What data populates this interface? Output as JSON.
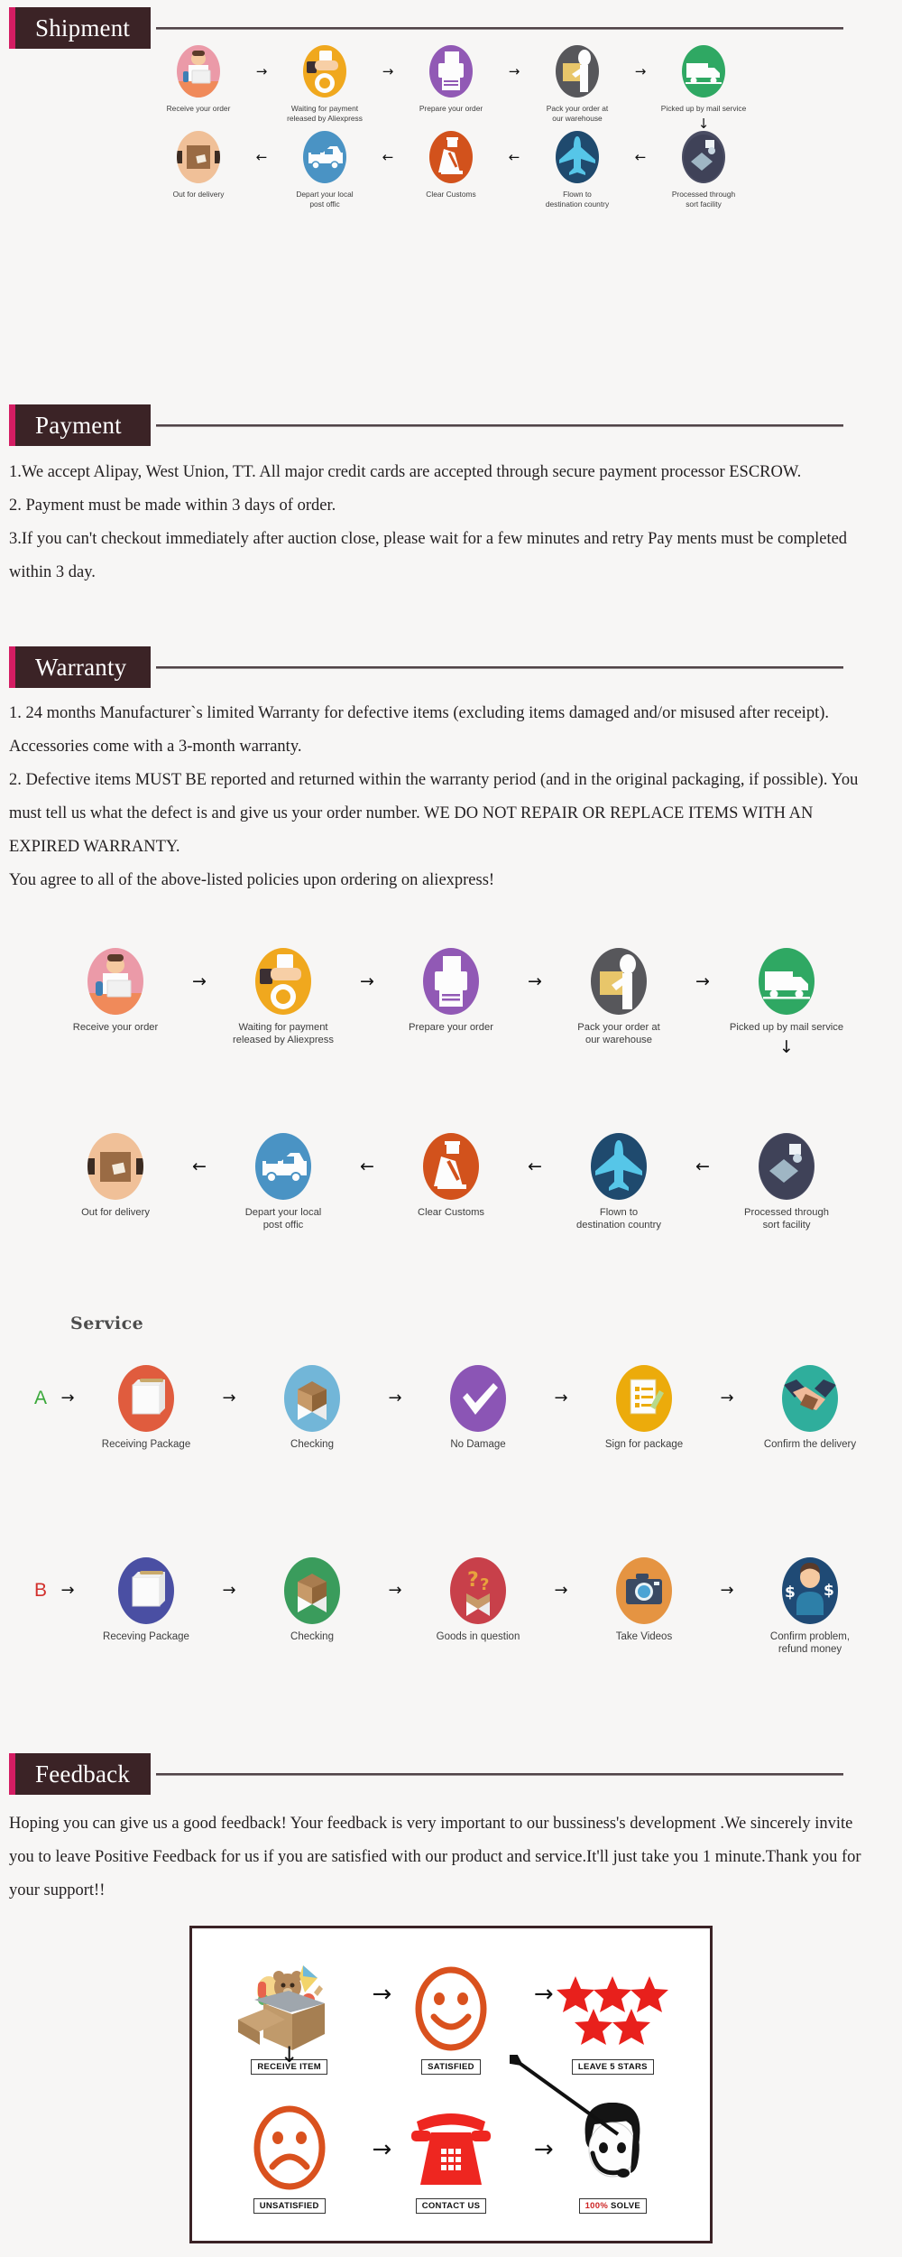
{
  "page": {
    "background": "#f7f6f5",
    "accent_bar_color": "#d41d63",
    "plate_color": "#3b2326"
  },
  "sections": {
    "shipment": {
      "title": "Shipment"
    },
    "payment": {
      "title": "Payment",
      "paragraphs": [
        "1.We accept Alipay, West Union, TT. All major credit cards are accepted through secure payment processor ESCROW.",
        "2. Payment must be made within 3 days of order.",
        "3.If you can't checkout immediately after auction close, please wait for a few minutes and retry Pay ments must be completed within 3 day."
      ]
    },
    "warranty": {
      "title": "Warranty",
      "paragraphs": [
        "1. 24 months Manufacturer`s limited Warranty for defective items (excluding items damaged and/or misused after receipt). Accessories come with a 3-month warranty.",
        "2. Defective items MUST BE reported and returned within the warranty period (and in the original packaging, if possible). You must tell us what the defect is and give us your order number. WE DO NOT REPAIR OR REPLACE ITEMS WITH AN EXPIRED WARRANTY.",
        "You agree to all of the above-listed policies upon ordering on aliexpress!"
      ]
    },
    "service": {
      "title": "Service"
    },
    "feedback": {
      "title": "Feedback",
      "paragraphs": [
        "Hoping you can give us a good feedback! Your feedback is very important to our bussiness's development .We sincerely invite you to leave Positive Feedback for us if you are satisfied with our product and service.It'll just take you 1 minute.Thank you for your support!!"
      ]
    }
  },
  "shipping_flow": {
    "row1": [
      {
        "label": "Receive your order",
        "icon": "person-at-desk-icon",
        "color": "#eb9aa8"
      },
      {
        "label": "Waiting for payment\nreleased by Aliexpress",
        "icon": "hand-with-coin-icon",
        "color": "#f0a81e"
      },
      {
        "label": "Prepare your order",
        "icon": "printer-icon",
        "color": "#9159b5"
      },
      {
        "label": "Pack your order at\nour warehouse",
        "icon": "worker-packing-icon",
        "color": "#57575b"
      },
      {
        "label": "Picked up by mail service",
        "icon": "delivery-truck-icon",
        "color": "#2fa863"
      }
    ],
    "row2": [
      {
        "label": "Out for delivery",
        "icon": "parcel-box-icon",
        "color": "#f0c098"
      },
      {
        "label": "Depart your local\npost offic",
        "icon": "delivery-van-icon",
        "color": "#4a93c4"
      },
      {
        "label": "Clear  Customs",
        "icon": "customs-officer-icon",
        "color": "#d2521c"
      },
      {
        "label": "Flown to\ndestination country",
        "icon": "airplane-icon",
        "color": "#1f4a6e"
      },
      {
        "label": "Processed through\nsort facility",
        "icon": "sorting-facility-icon",
        "color": "#4a4d63"
      }
    ],
    "arrow_right": "→",
    "arrow_left": "←",
    "arrow_down": "↓"
  },
  "service_flow": {
    "row_a": {
      "letter": "A",
      "letter_color": "#3aa83a",
      "nodes": [
        {
          "label": "Receiving Package",
          "icon": "package-icon",
          "color": "#e05c3e"
        },
        {
          "label": "Checking",
          "icon": "open-box-icon",
          "color": "#72b6d8"
        },
        {
          "label": "No Damage",
          "icon": "check-mark-icon",
          "color": "#8b55b5"
        },
        {
          "label": "Sign for package",
          "icon": "signed-document-icon",
          "color": "#ecab0b"
        },
        {
          "label": "Confirm the delivery",
          "icon": "handshake-icon",
          "color": "#2fae9c"
        }
      ]
    },
    "row_b": {
      "letter": "B",
      "letter_color": "#d2302c",
      "nodes": [
        {
          "label": "Receving Package",
          "icon": "package-icon",
          "color": "#4a4fa3"
        },
        {
          "label": "Checking",
          "icon": "open-box-icon",
          "color": "#3a9c5c"
        },
        {
          "label": "Goods in question",
          "icon": "question-box-icon",
          "color": "#c8404a"
        },
        {
          "label": "Take Videos",
          "icon": "camera-icon",
          "color": "#e59442"
        },
        {
          "label": "Confirm problem,\nrefund money",
          "icon": "support-agent-money-icon",
          "color": "#1f4a75"
        }
      ]
    },
    "arrow_right": "→"
  },
  "feedback_chart": {
    "cells": [
      {
        "tag": "RECEIVE ITEM",
        "icon": "open-box-with-toys-icon"
      },
      {
        "tag": "SATISFIED",
        "icon": "smiley-face-icon"
      },
      {
        "tag": "LEAVE 5 STARS",
        "icon": "five-stars-icon",
        "stars": 5
      },
      {
        "tag": "UNSATISFIED",
        "icon": "sad-face-icon"
      },
      {
        "tag": "CONTACT US",
        "icon": "telephone-icon"
      },
      {
        "tag": "100% SOLVE",
        "icon": "support-agent-icon",
        "tag_prefix": "100%",
        "tag_suffix": " SOLVE"
      }
    ],
    "arrows": {
      "right": "→",
      "down": "↓",
      "diagonal_up": "↗"
    },
    "star_color": "#e8201c",
    "face_color": "#d9511e",
    "phone_color": "#ee2620",
    "border_color": "#3b2326"
  }
}
